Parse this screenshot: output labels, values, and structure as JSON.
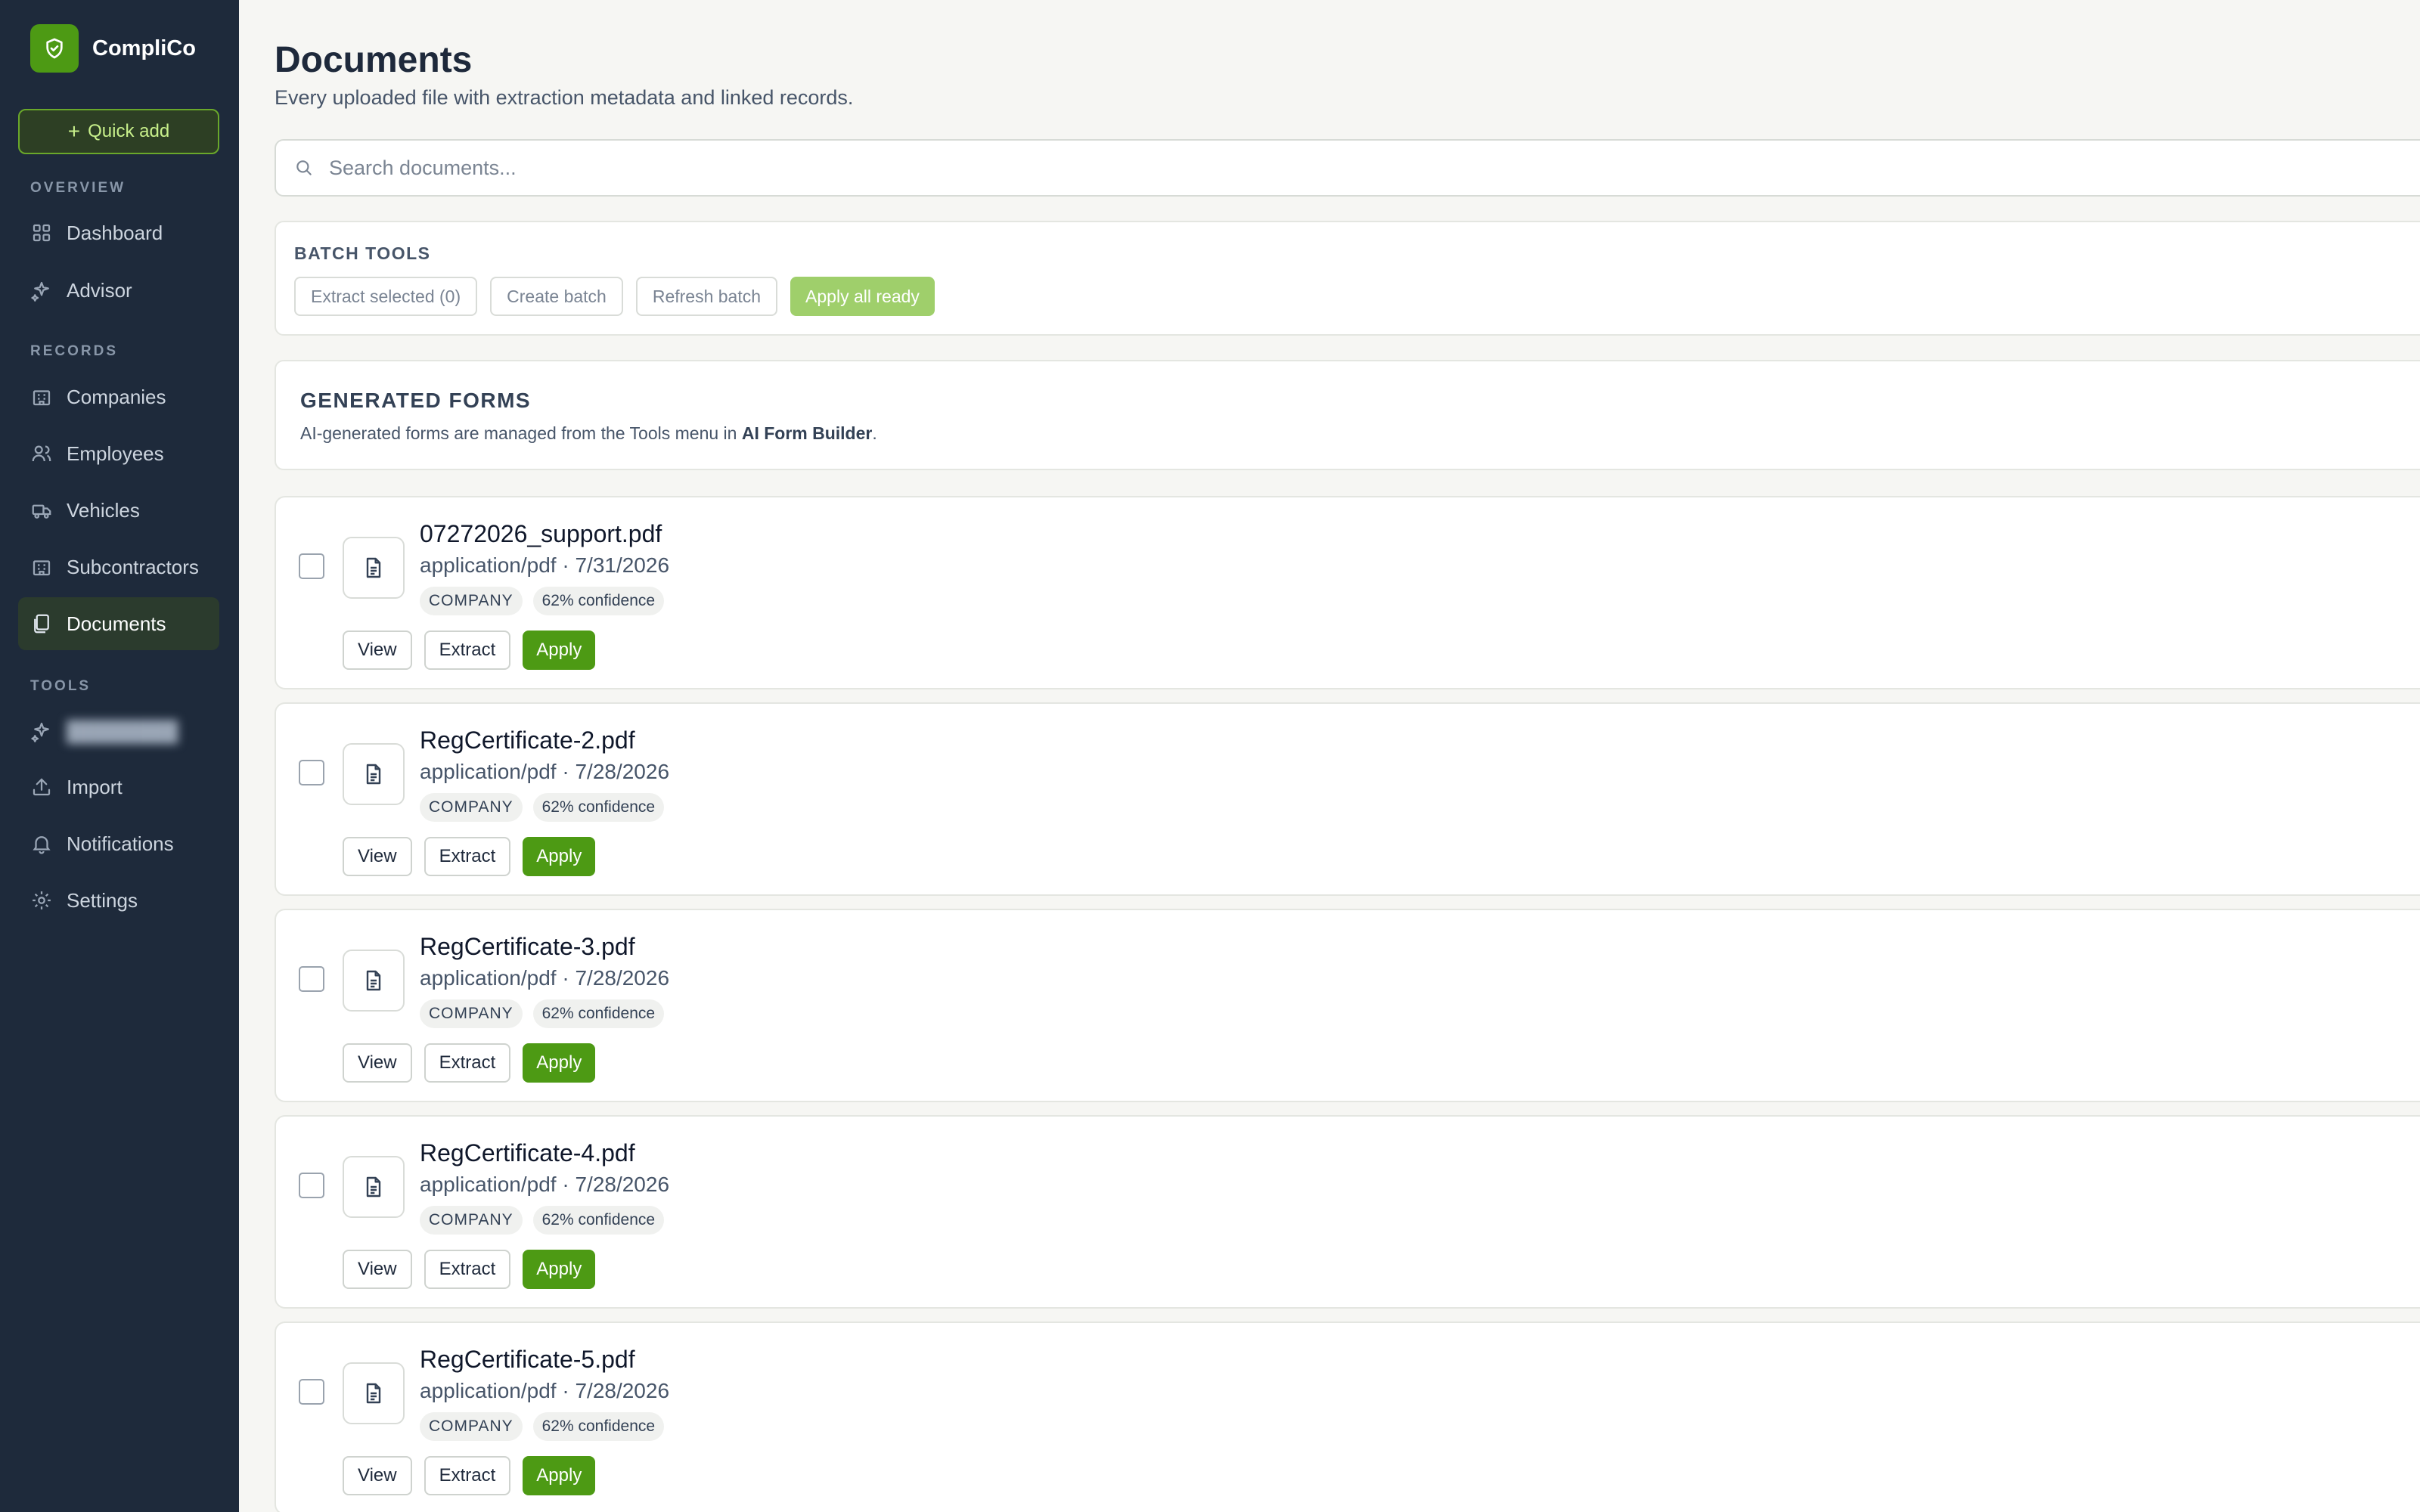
{
  "brand": {
    "name": "CompliCo",
    "logo_icon": "shield-check-icon",
    "accent": "#4d9a14"
  },
  "sidebar": {
    "quick_add_label": "Quick add",
    "sections": {
      "overview": "OVERVIEW",
      "records": "RECORDS",
      "tools": "TOOLS"
    },
    "items": [
      {
        "label": "Dashboard",
        "icon": "grid-icon"
      },
      {
        "label": "Advisor",
        "icon": "sparkle-icon"
      },
      {
        "label": "Companies",
        "icon": "building-icon"
      },
      {
        "label": "Employees",
        "icon": "users-icon"
      },
      {
        "label": "Vehicles",
        "icon": "truck-icon"
      },
      {
        "label": "Subcontractors",
        "icon": "building-icon"
      },
      {
        "label": "Documents",
        "icon": "documents-icon",
        "active": true
      },
      {
        "label": "",
        "icon": "sparkle-icon",
        "blurred": true
      },
      {
        "label": "Import",
        "icon": "upload-icon"
      },
      {
        "label": "Notifications",
        "icon": "bell-icon"
      },
      {
        "label": "Settings",
        "icon": "gear-icon"
      }
    ]
  },
  "main": {
    "title": "Documents",
    "subtitle": "Every uploaded file with extraction metadata and linked records.",
    "search": {
      "placeholder": "Search documents...",
      "value": ""
    },
    "batch_tools": {
      "title": "BATCH TOOLS",
      "extract_label": "Extract selected (0)",
      "create_label": "Create batch",
      "refresh_label": "Refresh batch",
      "apply_all_label": "Apply all ready"
    },
    "generated_forms": {
      "title": "GENERATED FORMS",
      "text_before": "AI-generated forms are managed from the Tools menu in ",
      "link_text": "AI Form Builder",
      "text_after": "."
    },
    "documents": [
      {
        "name": "07272026_support.pdf",
        "meta": "application/pdf · 7/31/2026",
        "type_badge": "COMPANY",
        "confidence": "62% confidence"
      },
      {
        "name": "RegCertificate-2.pdf",
        "meta": "application/pdf · 7/28/2026",
        "type_badge": "COMPANY",
        "confidence": "62% confidence"
      },
      {
        "name": "RegCertificate-3.pdf",
        "meta": "application/pdf · 7/28/2026",
        "type_badge": "COMPANY",
        "confidence": "62% confidence"
      },
      {
        "name": "RegCertificate-4.pdf",
        "meta": "application/pdf · 7/28/2026",
        "type_badge": "COMPANY",
        "confidence": "62% confidence"
      },
      {
        "name": "RegCertificate-5.pdf",
        "meta": "application/pdf · 7/28/2026",
        "type_badge": "COMPANY",
        "confidence": "62% confidence"
      }
    ],
    "doc_actions": {
      "view": "View",
      "extract": "Extract",
      "apply": "Apply"
    }
  }
}
